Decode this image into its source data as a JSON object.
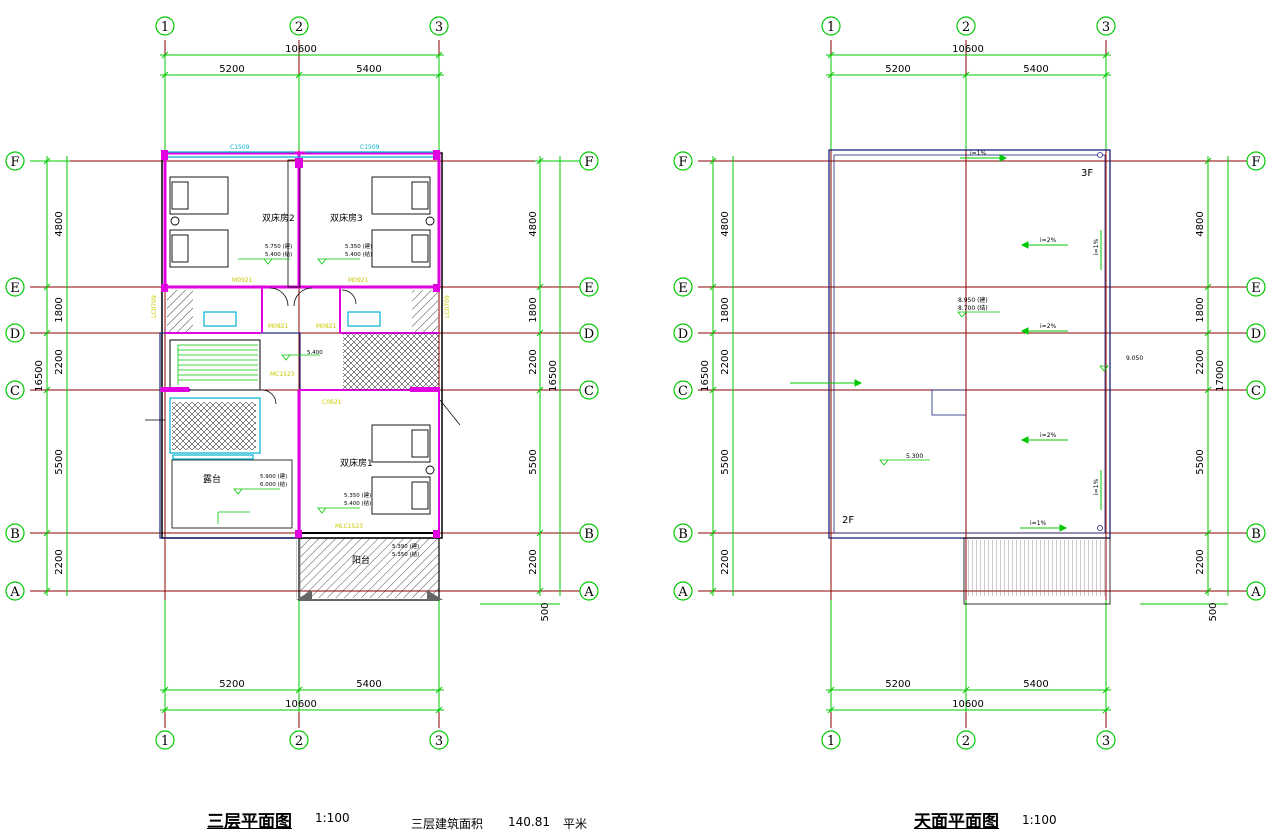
{
  "plan_left": {
    "grid_cols": [
      "1",
      "2",
      "3"
    ],
    "grid_rows": [
      "F",
      "E",
      "D",
      "C",
      "B",
      "A"
    ],
    "dims_top": [
      "10600",
      "5200",
      "5400"
    ],
    "dims_bottom": [
      "5200",
      "5400",
      "10600"
    ],
    "dims_side": [
      "4800",
      "1800",
      "2200",
      "5500",
      "2200",
      "16500",
      "500"
    ],
    "rooms": [
      "双床房2",
      "双床房3",
      "双床房1",
      "露台",
      "阳台"
    ],
    "levels": [
      "5.750 (建)",
      "5.400 (结)",
      "5.350 (建)",
      "5.400 (结)",
      "5.900 (建)",
      "6.000 (结)",
      "5.350 (建)",
      "5.400 (结)",
      "5.390 (建)",
      "5.350 (结)",
      "5.400"
    ],
    "tags": [
      "M0921",
      "M0821",
      "MC1523",
      "C0621",
      "C1509",
      "LC0709",
      "MLC1523"
    ],
    "title": "三层平面图",
    "scale": "1:100",
    "area_label": "三层建筑面积",
    "area_value": "140.81",
    "area_unit": "平米"
  },
  "plan_right": {
    "grid_cols": [
      "1",
      "2",
      "3"
    ],
    "grid_rows": [
      "F",
      "E",
      "D",
      "C",
      "B",
      "A"
    ],
    "dims_top": [
      "10600",
      "5200",
      "5400"
    ],
    "dims_bottom": [
      "5200",
      "5400",
      "10600"
    ],
    "dims_side": [
      "4800",
      "1800",
      "2200",
      "5500",
      "2200",
      "16500",
      "17000",
      "500"
    ],
    "floor_marks": [
      "3F",
      "2F"
    ],
    "levels": [
      "8.950 (建)",
      "8.700 (结)",
      "5.300",
      "9.050"
    ],
    "slopes": [
      "i=1%",
      "i=2%",
      "i=2%",
      "i=2%",
      "i=1%",
      "i=1%",
      "i=1%"
    ],
    "title": "天面平面图",
    "scale": "1:100"
  },
  "colors": {
    "grid_axis": "#8b0000",
    "dimension": "#00c800",
    "wall_accent": "#e000e0",
    "window": "#00b0d0",
    "tag": "#e8e800",
    "roof_outline": "#1a237e"
  }
}
